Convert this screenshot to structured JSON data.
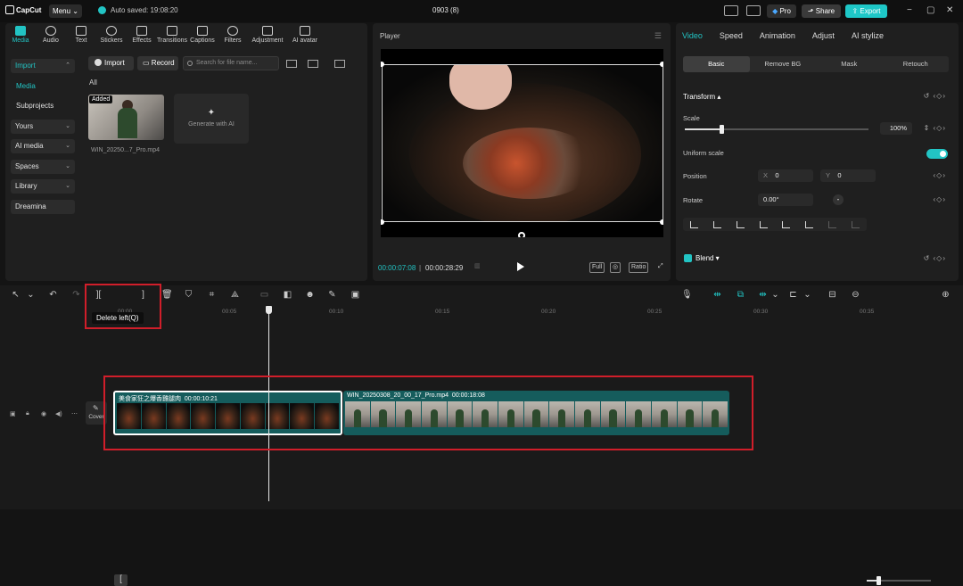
{
  "titlebar": {
    "app_name": "CapCut",
    "menu_label": "Menu ⌄",
    "autosave_text": "Auto saved: 19:08:20",
    "project_title": "0903 (8)",
    "pro_label": "Pro",
    "share_label": "Share",
    "export_label": "Export"
  },
  "media_toolbar": [
    {
      "label": "Media",
      "active": true
    },
    {
      "label": "Audio"
    },
    {
      "label": "Text"
    },
    {
      "label": "Stickers"
    },
    {
      "label": "Effects"
    },
    {
      "label": "Transitions"
    },
    {
      "label": "Captions"
    },
    {
      "label": "Filters"
    },
    {
      "label": "Adjustment"
    },
    {
      "label": "AI avatar"
    }
  ],
  "side_nav": {
    "import": "Import",
    "media": "Media",
    "subprojects": "Subprojects",
    "yours": "Yours",
    "ai_media": "AI media",
    "spaces": "Spaces",
    "library": "Library",
    "dreamina": "Dreamina"
  },
  "media_panel": {
    "import_btn": "Import",
    "record_btn": "Record",
    "search_placeholder": "Search for file name...",
    "filter_all": "All",
    "added_badge": "Added",
    "file_name": "WIN_20250...7_Pro.mp4",
    "generate_ai": "Generate with AI"
  },
  "player": {
    "title": "Player",
    "current_time": "00:00:07:08",
    "separator": "|",
    "total_time": "00:00:28:29",
    "full_label": "Full",
    "ratio_label": "Ratio"
  },
  "inspector": {
    "tabs": [
      "Video",
      "Speed",
      "Animation",
      "Adjust",
      "AI stylize"
    ],
    "subtabs": [
      "Basic",
      "Remove BG",
      "Mask",
      "Retouch"
    ],
    "transform": "Transform ▴",
    "scale_label": "Scale",
    "scale_value": "100%",
    "scale_fraction": 0.2,
    "uniform_scale": "Uniform scale",
    "position_label": "Position",
    "pos_x_label": "X",
    "pos_x": "0",
    "pos_y_label": "Y",
    "pos_y": "0",
    "rotate_label": "Rotate",
    "rotate_value": "0.00°",
    "blend_label": "Blend ▾"
  },
  "timeline": {
    "tooltip": "Delete left(Q)",
    "ruler": [
      "00:00",
      "00:05",
      "00:10",
      "00:15",
      "00:20",
      "00:25",
      "00:30",
      "00:35"
    ],
    "cover_label": "Cover",
    "clip1_label": "美食家狂之爆香雞腿肉",
    "clip1_duration": "00:00:10:21",
    "clip2_label": "WIN_20250308_20_00_17_Pro.mp4",
    "clip2_duration": "00:00:18:08"
  },
  "colors": {
    "accent": "#22c4c4",
    "highlight": "#d01e2a",
    "clip": "#155c5c"
  }
}
